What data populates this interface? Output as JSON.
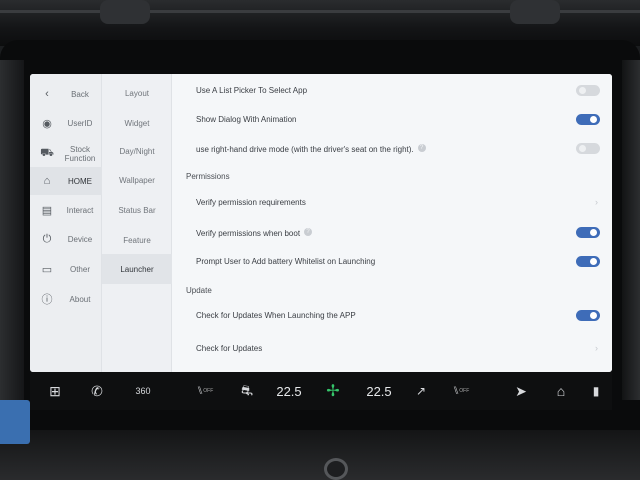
{
  "nav": {
    "back_label": "Back",
    "items": [
      {
        "icon": "user-icon",
        "glyph": "◉",
        "label": "UserID"
      },
      {
        "icon": "car-icon",
        "glyph": "⛟",
        "label": "Stock Function"
      },
      {
        "icon": "home-icon",
        "glyph": "⌂",
        "label": "HOME",
        "active": true
      },
      {
        "icon": "interact-icon",
        "glyph": "▤",
        "label": "Interact"
      },
      {
        "icon": "power-icon",
        "glyph": "⏻",
        "label": "Device"
      },
      {
        "icon": "box-icon",
        "glyph": "▭",
        "label": "Other"
      },
      {
        "icon": "info-icon",
        "glyph": "ⓘ",
        "label": "About"
      }
    ]
  },
  "subnav": {
    "items": [
      "Layout",
      "Widget",
      "Day/Night",
      "Wallpaper",
      "Status Bar",
      "Feature",
      "Launcher"
    ],
    "active": "Launcher"
  },
  "content": {
    "rows": {
      "list_picker": {
        "label": "Use A List Picker To Select App",
        "state": "off"
      },
      "dialog_anim": {
        "label": "Show Dialog With Animation",
        "state": "on"
      },
      "rhd": {
        "label": "use right-hand drive mode (with the driver's seat on the right).",
        "state": "off",
        "help": "?"
      },
      "verify_req": {
        "label": "Verify permission requirements"
      },
      "verify_boot": {
        "label": "Verify permissions when boot",
        "state": "on",
        "help": "?"
      },
      "battery_whitelist": {
        "label": "Prompt User to Add battery Whitelist on Launching",
        "state": "on"
      },
      "check_launch": {
        "label": "Check for Updates When Launching the APP",
        "state": "on"
      },
      "check_updates": {
        "label": "Check for Updates"
      }
    },
    "sections": {
      "permissions": "Permissions",
      "update": "Update"
    }
  },
  "dock": {
    "temp_left": "22.5",
    "temp_right": "22.5",
    "rotate_label": "360",
    "seat_off_label": "OFF",
    "seat_off_right_label": "OFF"
  },
  "colors": {
    "accent": "#3e6cb8",
    "fan": "#35c46a"
  }
}
